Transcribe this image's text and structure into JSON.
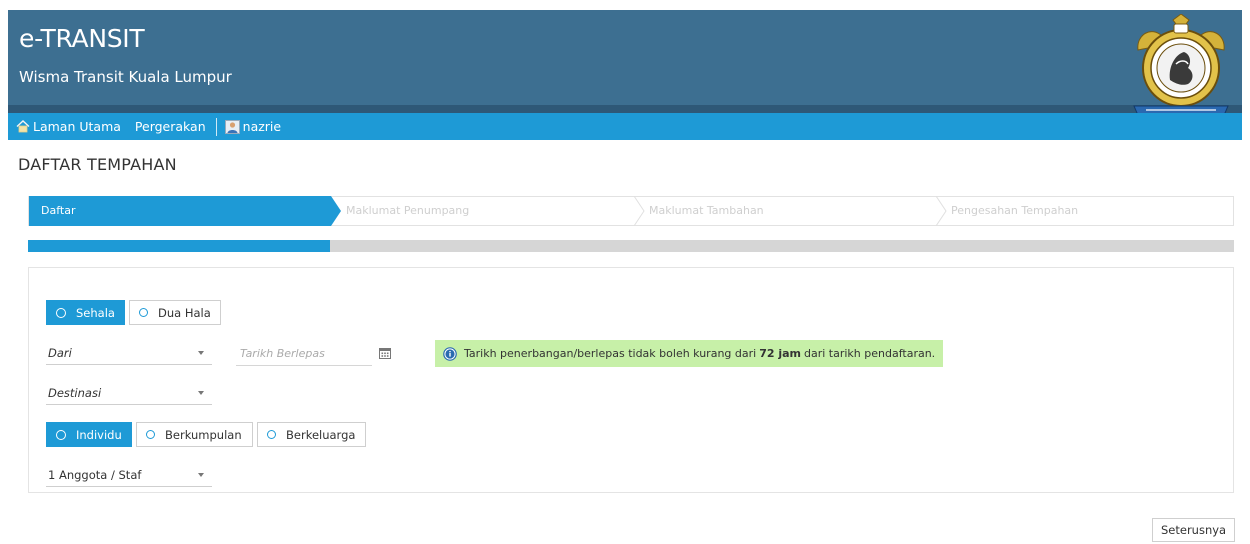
{
  "header": {
    "title": "e-TRANSIT",
    "subtitle": "Wisma Transit Kuala Lumpur"
  },
  "nav": {
    "home": "Laman Utama",
    "movement": "Pergerakan",
    "user": "nazrie"
  },
  "page": {
    "title": "DAFTAR TEMPAHAN"
  },
  "wizard": {
    "steps": [
      "Daftar",
      "Maklumat Penumpang",
      "Maklumat Tambahan",
      "Pengesahan Tempahan"
    ],
    "progress_percent": 25
  },
  "trip": {
    "options": [
      "Sehala",
      "Dua Hala"
    ],
    "selected": "Sehala"
  },
  "origin": {
    "value": "Dari"
  },
  "departure_date": {
    "placeholder": "Tarikh Berlepas"
  },
  "destination": {
    "value": "Destinasi"
  },
  "alert": {
    "before": "Tarikh penerbangan/berlepas tidak boleh kurang dari",
    "bold": "72 jam",
    "after": "dari tarikh pendaftaran."
  },
  "party": {
    "options": [
      "Individu",
      "Berkumpulan",
      "Berkeluarga"
    ],
    "selected": "Individu"
  },
  "count": {
    "value": "1 Anggota / Staf"
  },
  "actions": {
    "next": "Seterusnya"
  },
  "colors": {
    "header": "#3d6f91",
    "accent": "#1e9ad6",
    "alert_bg": "#c7f0a8"
  },
  "icons": {
    "home": "home-icon",
    "user": "user-icon",
    "calendar": "calendar-icon",
    "info": "info-icon",
    "crest": "crest-emblem"
  }
}
